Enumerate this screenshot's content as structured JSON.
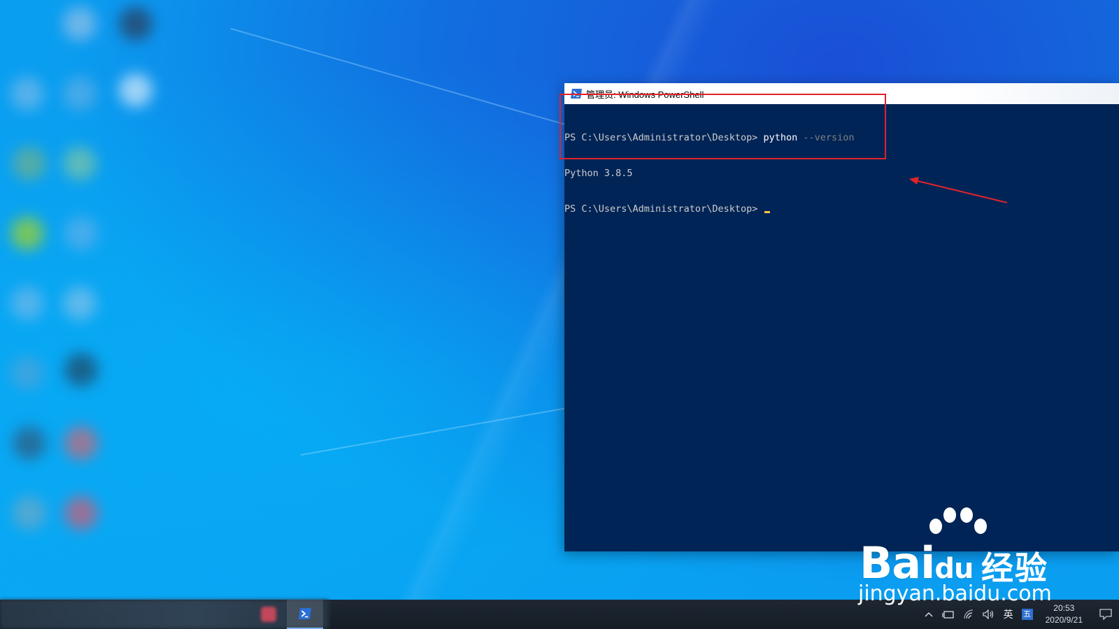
{
  "window": {
    "title": "管理员: Windows PowerShell",
    "icon": "powershell-icon"
  },
  "console": {
    "line1_prompt": "PS C:\\Users\\Administrator\\Desktop> ",
    "line1_command": "python",
    "line1_param": " --version",
    "line2_output": "Python 3.8.5",
    "line3_prompt": "PS C:\\Users\\Administrator\\Desktop> "
  },
  "annotations": {
    "highlight_color": "#e0232b",
    "arrow_color": "#e0232b"
  },
  "taskbar": {
    "apps": [
      {
        "name": "blurred-app-icon"
      },
      {
        "name": "powershell-icon",
        "active": true
      }
    ],
    "tray": {
      "ime_mode": "英",
      "ime_icon": "五",
      "time": "20:53",
      "date": "2020/9/21"
    }
  },
  "watermark": {
    "brand": "Bai",
    "brand_suffix": "du",
    "product": "经验",
    "url": "jingyan.baidu.com"
  },
  "colors": {
    "console_bg": "#012456",
    "console_text": "#cccccc",
    "param_text": "#808080",
    "cursor": "#f7c64b"
  }
}
